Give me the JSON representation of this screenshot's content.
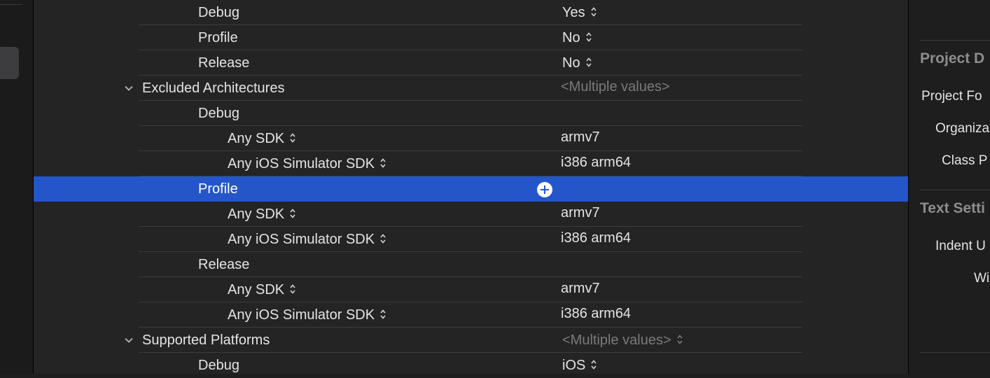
{
  "build_settings": {
    "valid_arch": {
      "debug_label": "Debug",
      "debug_value": "Yes",
      "profile_label": "Profile",
      "profile_value": "No",
      "release_label": "Release",
      "release_value": "No"
    },
    "excluded_arch": {
      "title": "Excluded Architectures",
      "multi_value": "<Multiple values>",
      "debug_label": "Debug",
      "profile_label": "Profile",
      "release_label": "Release",
      "any_sdk_label": "Any SDK",
      "any_sdk_value": "armv7",
      "sim_sdk_label": "Any iOS Simulator SDK",
      "sim_sdk_value": "i386 arm64"
    },
    "supported_platforms": {
      "title": "Supported Platforms",
      "multi_value": "<Multiple values>",
      "debug_label": "Debug",
      "debug_value": "iOS"
    }
  },
  "inspector": {
    "project_document_heading": "Project D",
    "project_format_label": "Project Fo",
    "organization_label": "Organiza",
    "class_prefix_label": "Class P",
    "text_settings_heading": "Text Setti",
    "indent_label": "Indent U",
    "widths_label": "Wi"
  },
  "colors": {
    "selection": "#2456c9",
    "editor_background": "#242424",
    "muted_text": "#7a7a7a"
  }
}
